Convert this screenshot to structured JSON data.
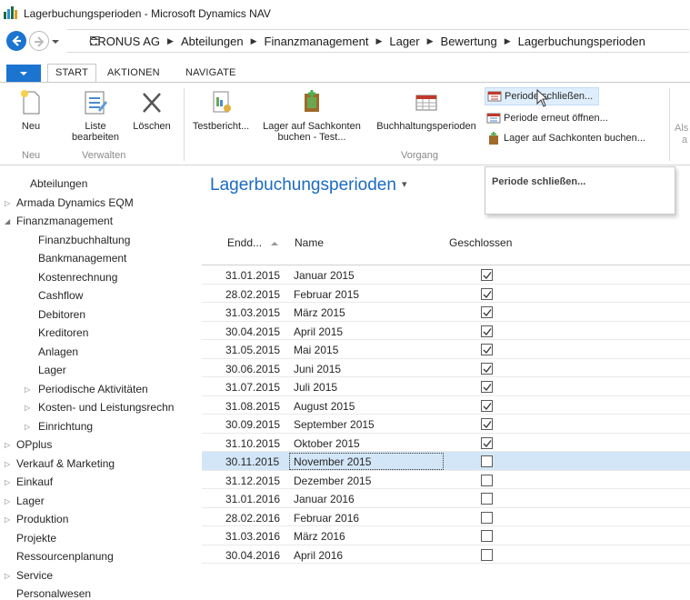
{
  "window": {
    "title": "Lagerbuchungsperioden - Microsoft Dynamics NAV"
  },
  "addressbar": {
    "crumbs": [
      "CRONUS AG",
      "Abteilungen",
      "Finanzmanagement",
      "Lager",
      "Bewertung",
      "Lagerbuchungsperioden"
    ]
  },
  "ribbon": {
    "tabs": [
      "START",
      "AKTIONEN",
      "NAVIGATE"
    ],
    "buttons": {
      "neu": "Neu",
      "liste_bearbeiten_1": "Liste",
      "liste_bearbeiten_2": "bearbeiten",
      "loeschen": "Löschen",
      "testbericht": "Testbericht...",
      "lager_sachkonten_1": "Lager auf Sachkonten",
      "lager_sachkonten_2": "buchen - Test...",
      "buchhaltungsperioden": "Buchhaltungsperioden",
      "periode_schliessen": "Periode schließen...",
      "periode_oeffnen": "Periode erneut öffnen...",
      "lager_sachkonten_buchen": "Lager auf Sachkonten buchen...",
      "cut_text_1": "Als",
      "cut_text_2": "a"
    },
    "groups": {
      "neu": "Neu",
      "verwalten": "Verwalten",
      "vorgang": "Vorgang"
    }
  },
  "tooltip": {
    "text": "Periode schließen..."
  },
  "nav": {
    "items": [
      "Abteilungen",
      "Armada Dynamics EQM",
      "Finanzmanagement",
      "Finanzbuchhaltung",
      "Bankmanagement",
      "Kostenrechnung",
      "Cashflow",
      "Debitoren",
      "Kreditoren",
      "Anlagen",
      "Lager",
      "Periodische Aktivitäten",
      "Kosten- und Leistungsrechn",
      "Einrichtung",
      "OPplus",
      "Verkauf & Marketing",
      "Einkauf",
      "Lager",
      "Produktion",
      "Projekte",
      "Ressourcenplanung",
      "Service",
      "Personalwesen"
    ]
  },
  "page": {
    "title": "Lagerbuchungsperioden",
    "columns": {
      "date": "Endd...",
      "name": "Name",
      "closed": "Geschlossen"
    }
  },
  "rows": [
    {
      "date": "31.01.2015",
      "name": "Januar 2015",
      "closed": true
    },
    {
      "date": "28.02.2015",
      "name": "Februar 2015",
      "closed": true
    },
    {
      "date": "31.03.2015",
      "name": "März 2015",
      "closed": true
    },
    {
      "date": "30.04.2015",
      "name": "April 2015",
      "closed": true
    },
    {
      "date": "31.05.2015",
      "name": "Mai 2015",
      "closed": true
    },
    {
      "date": "30.06.2015",
      "name": "Juni 2015",
      "closed": true
    },
    {
      "date": "31.07.2015",
      "name": "Juli 2015",
      "closed": true
    },
    {
      "date": "31.08.2015",
      "name": "August 2015",
      "closed": true
    },
    {
      "date": "30.09.2015",
      "name": "September 2015",
      "closed": true
    },
    {
      "date": "31.10.2015",
      "name": "Oktober 2015",
      "closed": true
    },
    {
      "date": "30.11.2015",
      "name": "November 2015",
      "closed": false,
      "selected": true
    },
    {
      "date": "31.12.2015",
      "name": "Dezember 2015",
      "closed": false
    },
    {
      "date": "31.01.2016",
      "name": "Januar 2016",
      "closed": false
    },
    {
      "date": "28.02.2016",
      "name": "Februar 2016",
      "closed": false
    },
    {
      "date": "31.03.2016",
      "name": "März 2016",
      "closed": false
    },
    {
      "date": "30.04.2016",
      "name": "April 2016",
      "closed": false
    }
  ],
  "colors": {
    "accent": "#1b74d0",
    "title": "#1b6bc2",
    "selected_row": "#d3e6f8"
  }
}
